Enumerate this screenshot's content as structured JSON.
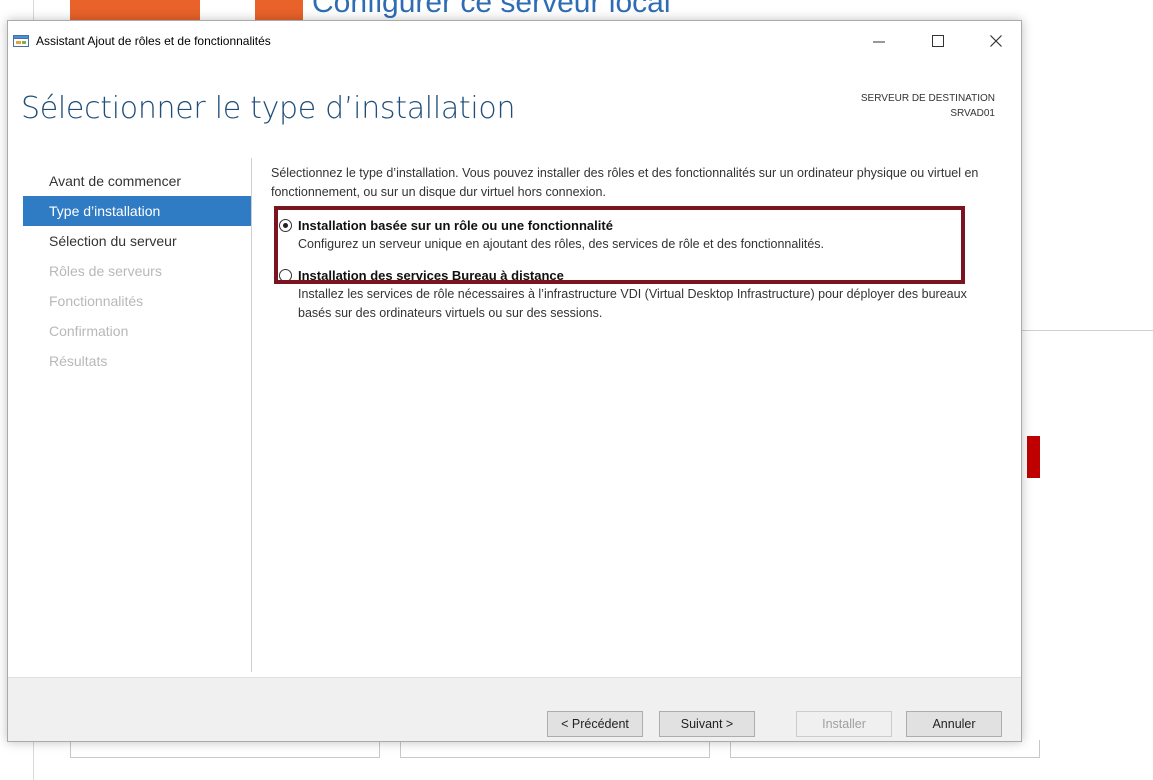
{
  "background": {
    "title_fragment": "Configurer ce serveur local"
  },
  "window": {
    "title": "Assistant Ajout de rôles et de fonctionnalités",
    "controls": {
      "minimize": "—",
      "maximize": "☐",
      "close": "✕"
    }
  },
  "header": {
    "page_title": "Sélectionner le type d’installation",
    "destination_label": "SERVEUR DE DESTINATION",
    "destination_server": "SRVAD01"
  },
  "nav": {
    "items": [
      {
        "label": "Avant de commencer",
        "state": "normal"
      },
      {
        "label": "Type d’installation",
        "state": "active"
      },
      {
        "label": "Sélection du serveur",
        "state": "normal"
      },
      {
        "label": "Rôles de serveurs",
        "state": "disabled"
      },
      {
        "label": "Fonctionnalités",
        "state": "disabled"
      },
      {
        "label": "Confirmation",
        "state": "disabled"
      },
      {
        "label": "Résultats",
        "state": "disabled"
      }
    ]
  },
  "content": {
    "intro": "Sélectionnez le type d’installation. Vous pouvez installer des rôles et des fonctionnalités sur un ordinateur physique ou virtuel en fonctionnement, ou sur un disque dur virtuel hors connexion.",
    "options": [
      {
        "title": "Installation basée sur un rôle ou une fonctionnalité",
        "description": "Configurez un serveur unique en ajoutant des rôles, des services de rôle et des fonctionnalités.",
        "selected": true
      },
      {
        "title": "Installation des services Bureau à distance",
        "description": "Installez les services de rôle nécessaires à l’infrastructure VDI (Virtual Desktop Infrastructure) pour déployer des bureaux basés sur des ordinateurs virtuels ou sur des sessions.",
        "selected": false
      }
    ]
  },
  "footer": {
    "previous": "< Précédent",
    "next": "Suivant >",
    "install": "Installer",
    "cancel": "Annuler"
  },
  "colors": {
    "accent": "#2f7bc4",
    "highlight_border": "#7b1420",
    "title": "#1f4e79"
  }
}
